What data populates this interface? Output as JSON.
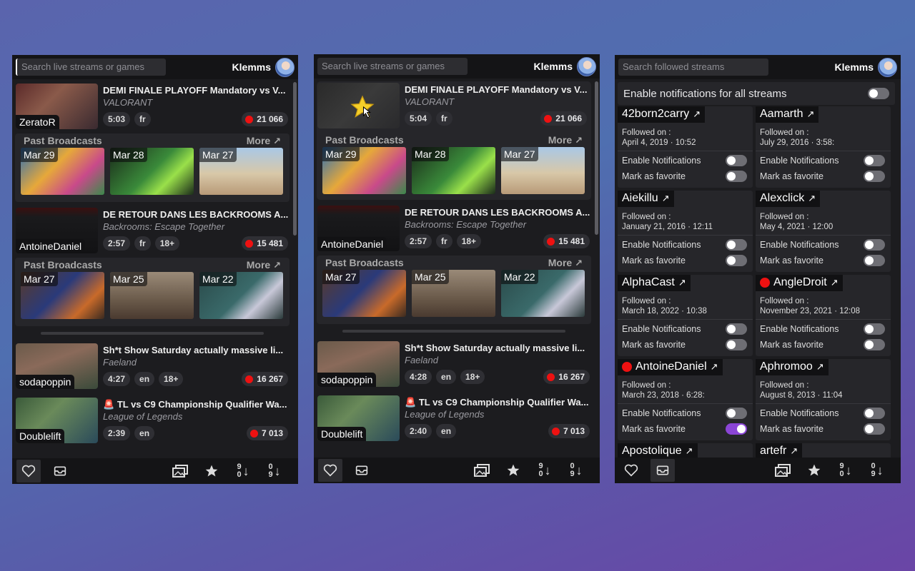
{
  "user": {
    "name": "Klemms"
  },
  "panels": {
    "live1": {
      "search_placeholder": "Search live streams or games"
    },
    "live2": {
      "search_placeholder": "Search live streams or games"
    },
    "followed": {
      "search_placeholder": "Search followed streams"
    }
  },
  "streams": [
    {
      "streamer": "ZeratoR",
      "title": "DEMI FINALE PLAYOFF Mandatory vs V...",
      "game": "VALORANT",
      "duration": "5:03",
      "duration2": "5:04",
      "lang": "fr",
      "viewers": "21 066",
      "past": [
        {
          "date": "Mar 29"
        },
        {
          "date": "Mar 28"
        },
        {
          "date": "Mar 27"
        }
      ]
    },
    {
      "streamer": "AntoineDaniel",
      "title": "DE RETOUR DANS LES BACKROOMS A...",
      "game": "Backrooms: Escape Together",
      "duration": "2:57",
      "duration2": "2:57",
      "lang": "fr",
      "rating": "18+",
      "viewers": "15 481",
      "past": [
        {
          "date": "Mar 27"
        },
        {
          "date": "Mar 25"
        },
        {
          "date": "Mar 22"
        }
      ]
    },
    {
      "streamer": "sodapoppin",
      "title": "Sh*t Show Saturday actually massive li...",
      "game": "Faeland",
      "duration": "4:27",
      "duration2": "4:28",
      "lang": "en",
      "rating": "18+",
      "viewers": "16 267"
    },
    {
      "streamer": "Doublelift",
      "title": "TL vs C9 Championship Qualifier Wa...",
      "game": "League of Legends",
      "duration": "2:39",
      "duration2": "2:40",
      "lang": "en",
      "viewers": "7 013"
    }
  ],
  "past_broadcasts_label": "Past Broadcasts",
  "more_label": "More",
  "followed": {
    "enable_all_label": "Enable notifications for all streams",
    "followed_on_label": "Followed on :",
    "enable_notif_label": "Enable Notifications",
    "favorite_label": "Mark as favorite",
    "items": [
      {
        "name": "42born2carry",
        "date": "April 4, 2019 · 10:52",
        "live": false,
        "notif": false,
        "fav": false
      },
      {
        "name": "Aamarth",
        "date": "July 29, 2016 · 3:58:",
        "live": false,
        "notif": false,
        "fav": false
      },
      {
        "name": "Aiekillu",
        "date": "January 21, 2016 · 12:11",
        "live": false,
        "notif": false,
        "fav": false
      },
      {
        "name": "Alexclick",
        "date": "May 4, 2021 · 12:00",
        "live": false,
        "notif": false,
        "fav": false
      },
      {
        "name": "AlphaCast",
        "date": "March 18, 2022 · 10:38",
        "live": false,
        "notif": false,
        "fav": false
      },
      {
        "name": "AngleDroit",
        "date": "November 23, 2021 · 12:08",
        "live": true,
        "notif": false,
        "fav": false
      },
      {
        "name": "AntoineDaniel",
        "date": "March 23, 2018 · 6:28:",
        "live": true,
        "notif": false,
        "fav": true
      },
      {
        "name": "Aphromoo",
        "date": "August 8, 2013 · 11:04",
        "live": false,
        "notif": false,
        "fav": false
      },
      {
        "name": "Apostolique",
        "date": "",
        "live": false
      },
      {
        "name": "artefr",
        "date": "",
        "live": false
      }
    ]
  },
  "sort": {
    "desc_top": "9",
    "desc_bottom": "0",
    "asc_top": "0",
    "asc_bottom": "9"
  },
  "colors": {
    "live_red": "#e11111",
    "accent_purple": "#8b45d6",
    "background": "#1c1c1f"
  }
}
